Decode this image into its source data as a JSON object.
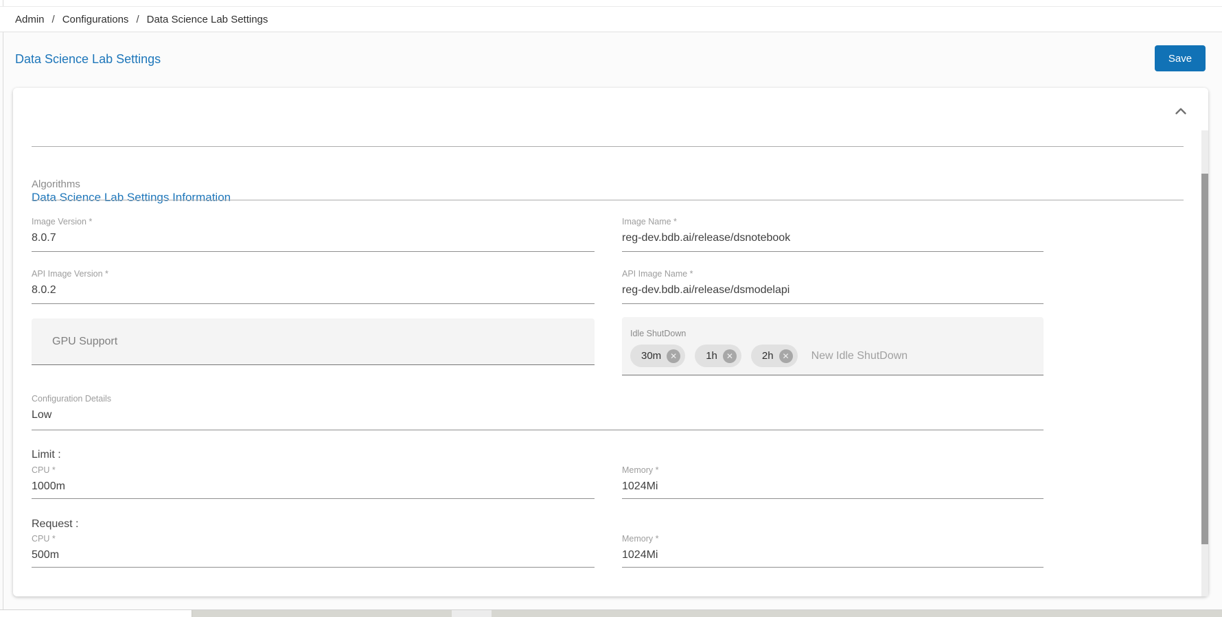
{
  "breadcrumb": {
    "separator": "/",
    "items": [
      {
        "label": "Admin"
      },
      {
        "label": "Configurations"
      },
      {
        "label": "Data Science Lab Settings"
      }
    ]
  },
  "page": {
    "title": "Data Science Lab Settings",
    "save_button": "Save"
  },
  "panel": {
    "title": "Data Science Lab Settings Information",
    "section": "Algorithms",
    "image_version": {
      "label": "Image Version *",
      "value": "8.0.7"
    },
    "image_name": {
      "label": "Image Name *",
      "value": "reg-dev.bdb.ai/release/dsnotebook"
    },
    "api_image_version": {
      "label": "API Image Version *",
      "value": "8.0.2"
    },
    "api_image_name": {
      "label": "API Image Name *",
      "value": "reg-dev.bdb.ai/release/dsmodelapi"
    },
    "gpu_support_label": "GPU Support",
    "idle_shutdown": {
      "label": "Idle ShutDown",
      "chips": [
        "30m",
        "1h",
        "2h"
      ],
      "placeholder": "New Idle ShutDown"
    },
    "configuration_details": {
      "label": "Configuration Details",
      "value": "Low"
    },
    "limit": {
      "heading": "Limit :",
      "cpu_label": "CPU *",
      "cpu_value": "1000m",
      "memory_label": "Memory *",
      "memory_value": "1024Mi"
    },
    "request": {
      "heading": "Request :",
      "cpu_label": "CPU *",
      "cpu_value": "500m",
      "memory_label": "Memory *",
      "memory_value": "1024Mi"
    }
  },
  "icons": {
    "close_glyph": "✕"
  },
  "colors": {
    "accent_blue": "#1d76ba",
    "save_button_bg": "#1172b6",
    "chip_bg": "#e1e1e1",
    "filled_field_bg": "#f4f4f4"
  }
}
